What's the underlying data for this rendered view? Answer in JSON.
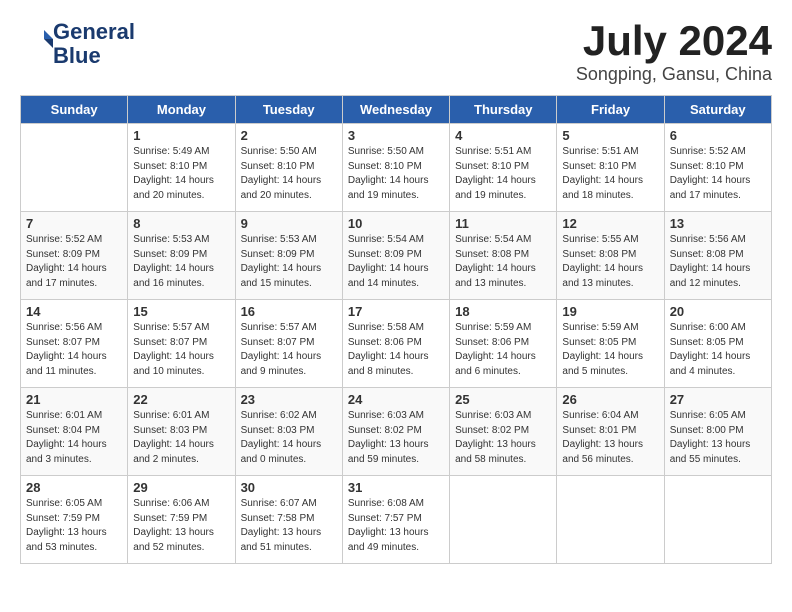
{
  "logo": {
    "line1": "General",
    "line2": "Blue"
  },
  "title": "July 2024",
  "location": "Songping, Gansu, China",
  "weekdays": [
    "Sunday",
    "Monday",
    "Tuesday",
    "Wednesday",
    "Thursday",
    "Friday",
    "Saturday"
  ],
  "weeks": [
    [
      {
        "day": "",
        "info": ""
      },
      {
        "day": "1",
        "info": "Sunrise: 5:49 AM\nSunset: 8:10 PM\nDaylight: 14 hours\nand 20 minutes."
      },
      {
        "day": "2",
        "info": "Sunrise: 5:50 AM\nSunset: 8:10 PM\nDaylight: 14 hours\nand 20 minutes."
      },
      {
        "day": "3",
        "info": "Sunrise: 5:50 AM\nSunset: 8:10 PM\nDaylight: 14 hours\nand 19 minutes."
      },
      {
        "day": "4",
        "info": "Sunrise: 5:51 AM\nSunset: 8:10 PM\nDaylight: 14 hours\nand 19 minutes."
      },
      {
        "day": "5",
        "info": "Sunrise: 5:51 AM\nSunset: 8:10 PM\nDaylight: 14 hours\nand 18 minutes."
      },
      {
        "day": "6",
        "info": "Sunrise: 5:52 AM\nSunset: 8:10 PM\nDaylight: 14 hours\nand 17 minutes."
      }
    ],
    [
      {
        "day": "7",
        "info": "Sunrise: 5:52 AM\nSunset: 8:09 PM\nDaylight: 14 hours\nand 17 minutes."
      },
      {
        "day": "8",
        "info": "Sunrise: 5:53 AM\nSunset: 8:09 PM\nDaylight: 14 hours\nand 16 minutes."
      },
      {
        "day": "9",
        "info": "Sunrise: 5:53 AM\nSunset: 8:09 PM\nDaylight: 14 hours\nand 15 minutes."
      },
      {
        "day": "10",
        "info": "Sunrise: 5:54 AM\nSunset: 8:09 PM\nDaylight: 14 hours\nand 14 minutes."
      },
      {
        "day": "11",
        "info": "Sunrise: 5:54 AM\nSunset: 8:08 PM\nDaylight: 14 hours\nand 13 minutes."
      },
      {
        "day": "12",
        "info": "Sunrise: 5:55 AM\nSunset: 8:08 PM\nDaylight: 14 hours\nand 13 minutes."
      },
      {
        "day": "13",
        "info": "Sunrise: 5:56 AM\nSunset: 8:08 PM\nDaylight: 14 hours\nand 12 minutes."
      }
    ],
    [
      {
        "day": "14",
        "info": "Sunrise: 5:56 AM\nSunset: 8:07 PM\nDaylight: 14 hours\nand 11 minutes."
      },
      {
        "day": "15",
        "info": "Sunrise: 5:57 AM\nSunset: 8:07 PM\nDaylight: 14 hours\nand 10 minutes."
      },
      {
        "day": "16",
        "info": "Sunrise: 5:57 AM\nSunset: 8:07 PM\nDaylight: 14 hours\nand 9 minutes."
      },
      {
        "day": "17",
        "info": "Sunrise: 5:58 AM\nSunset: 8:06 PM\nDaylight: 14 hours\nand 8 minutes."
      },
      {
        "day": "18",
        "info": "Sunrise: 5:59 AM\nSunset: 8:06 PM\nDaylight: 14 hours\nand 6 minutes."
      },
      {
        "day": "19",
        "info": "Sunrise: 5:59 AM\nSunset: 8:05 PM\nDaylight: 14 hours\nand 5 minutes."
      },
      {
        "day": "20",
        "info": "Sunrise: 6:00 AM\nSunset: 8:05 PM\nDaylight: 14 hours\nand 4 minutes."
      }
    ],
    [
      {
        "day": "21",
        "info": "Sunrise: 6:01 AM\nSunset: 8:04 PM\nDaylight: 14 hours\nand 3 minutes."
      },
      {
        "day": "22",
        "info": "Sunrise: 6:01 AM\nSunset: 8:03 PM\nDaylight: 14 hours\nand 2 minutes."
      },
      {
        "day": "23",
        "info": "Sunrise: 6:02 AM\nSunset: 8:03 PM\nDaylight: 14 hours\nand 0 minutes."
      },
      {
        "day": "24",
        "info": "Sunrise: 6:03 AM\nSunset: 8:02 PM\nDaylight: 13 hours\nand 59 minutes."
      },
      {
        "day": "25",
        "info": "Sunrise: 6:03 AM\nSunset: 8:02 PM\nDaylight: 13 hours\nand 58 minutes."
      },
      {
        "day": "26",
        "info": "Sunrise: 6:04 AM\nSunset: 8:01 PM\nDaylight: 13 hours\nand 56 minutes."
      },
      {
        "day": "27",
        "info": "Sunrise: 6:05 AM\nSunset: 8:00 PM\nDaylight: 13 hours\nand 55 minutes."
      }
    ],
    [
      {
        "day": "28",
        "info": "Sunrise: 6:05 AM\nSunset: 7:59 PM\nDaylight: 13 hours\nand 53 minutes."
      },
      {
        "day": "29",
        "info": "Sunrise: 6:06 AM\nSunset: 7:59 PM\nDaylight: 13 hours\nand 52 minutes."
      },
      {
        "day": "30",
        "info": "Sunrise: 6:07 AM\nSunset: 7:58 PM\nDaylight: 13 hours\nand 51 minutes."
      },
      {
        "day": "31",
        "info": "Sunrise: 6:08 AM\nSunset: 7:57 PM\nDaylight: 13 hours\nand 49 minutes."
      },
      {
        "day": "",
        "info": ""
      },
      {
        "day": "",
        "info": ""
      },
      {
        "day": "",
        "info": ""
      }
    ]
  ]
}
